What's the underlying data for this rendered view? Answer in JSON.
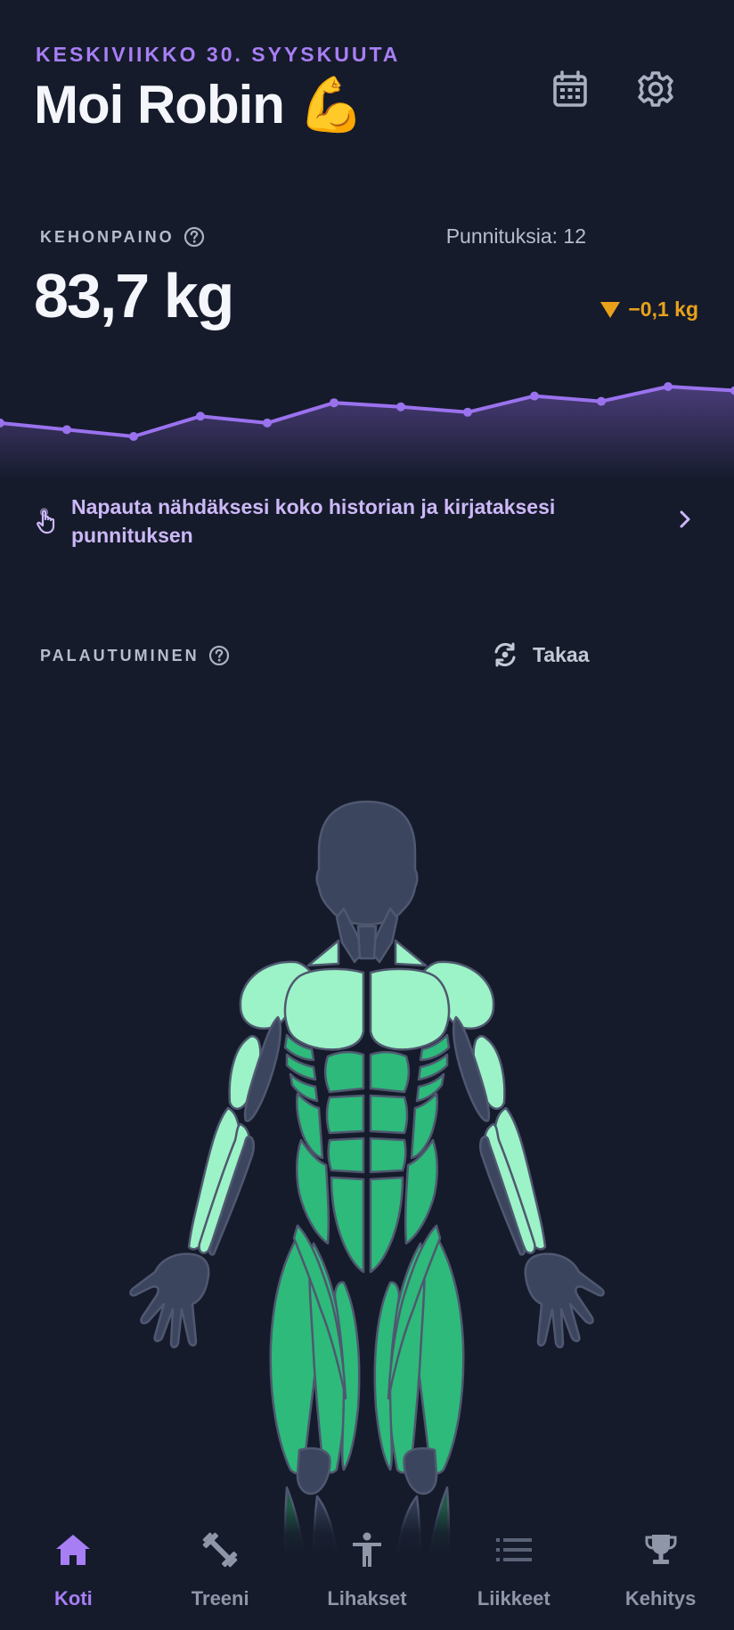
{
  "header": {
    "date": "KESKIVIIKKO 30. SYYSKUUTA",
    "greeting": "Moi Robin 💪",
    "calendar_icon": "calendar-icon",
    "settings_icon": "gear-icon"
  },
  "weight": {
    "label": "KEHONPAINO",
    "count_text": "Punnituksia: 12",
    "value": "83,7 kg",
    "change": "−0,1 kg",
    "trend_values": [
      83.5,
      83.45,
      83.4,
      83.55,
      83.5,
      83.65,
      83.62,
      83.58,
      83.7,
      83.66,
      83.77,
      83.74
    ],
    "history_link": "Napauta nähdäksesi koko historian ja kirjataksesi punnituksen"
  },
  "recovery": {
    "label": "PALAUTUMINEN",
    "view_toggle": "Takaa",
    "colors": {
      "recovered_light": "#9cf3c7",
      "recovered": "#2dba7b",
      "inactive": "#3b465e"
    }
  },
  "nav": {
    "items": [
      {
        "label": "Koti",
        "icon": "home-icon",
        "active": true
      },
      {
        "label": "Treeni",
        "icon": "dumbbell-icon",
        "active": false
      },
      {
        "label": "Lihakset",
        "icon": "figure-icon",
        "active": false
      },
      {
        "label": "Liikkeet",
        "icon": "list-icon",
        "active": false
      },
      {
        "label": "Kehitys",
        "icon": "trophy-icon",
        "active": false
      }
    ]
  },
  "colors": {
    "background": "#151b2b",
    "accent": "#a87ef5",
    "warning": "#e8a21a"
  }
}
